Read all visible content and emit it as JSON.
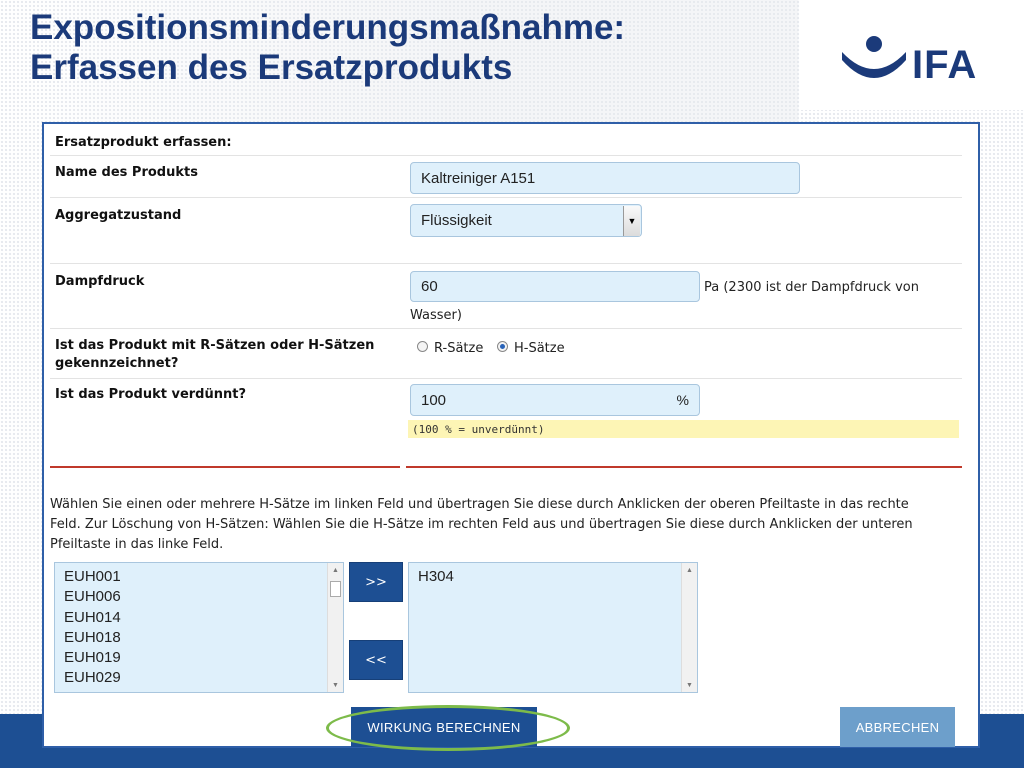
{
  "slide": {
    "title_line1": "Expositionsminderungsmaßnahme:",
    "title_line2": "Erfassen des Ersatzprodukts",
    "logo_text": "IFA"
  },
  "form": {
    "section_title": "Ersatzprodukt erfassen:",
    "product_name": {
      "label": "Name des Produkts",
      "value": "Kaltreiniger A151"
    },
    "aggregate": {
      "label": "Aggregatzustand",
      "selected": "Flüssigkeit"
    },
    "vapor_pressure": {
      "label": "Dampfdruck",
      "value": "60",
      "unit_note_1": "Pa (2300 ist der Dampfdruck von",
      "unit_note_2": "Wasser)"
    },
    "labeling": {
      "label_line1": "Ist das Produkt mit R-Sätzen oder H-Sätzen",
      "label_line2": "gekennzeichnet?",
      "option_r": "R-Sätze",
      "option_h": "H-Sätze",
      "selected": "H-Sätze"
    },
    "dilution": {
      "label": "Ist das Produkt verdünnt?",
      "value": "100",
      "unit": "%",
      "hint": "(100 % = unverdünnt)"
    },
    "instructions": {
      "line1": "Wählen Sie einen oder mehrere H-Sätze im linken Feld und übertragen Sie diese durch Anklicken der oberen Pfeiltaste in das rechte",
      "line2": "Feld. Zur Löschung von H-Sätzen: Wählen Sie die H-Sätze im rechten Feld aus und übertragen Sie diese durch Anklicken der unteren",
      "line3": "Pfeiltaste in das linke Feld."
    },
    "available_h_statements": [
      "EUH001",
      "EUH006",
      "EUH014",
      "EUH018",
      "EUH019",
      "EUH029"
    ],
    "selected_h_statements": [
      "H304"
    ],
    "move_right_label": ">>",
    "move_left_label": "<<",
    "calculate_button": "WIRKUNG BERECHNEN",
    "cancel_button": "ABBRECHEN"
  },
  "colors": {
    "brand_blue": "#1d4f93",
    "title_blue": "#1b3a7a",
    "field_bg": "#dff0fb",
    "hint_bg": "#fdf5b5",
    "divider_red": "#c0392b",
    "highlight_green": "#7dbb4a"
  }
}
